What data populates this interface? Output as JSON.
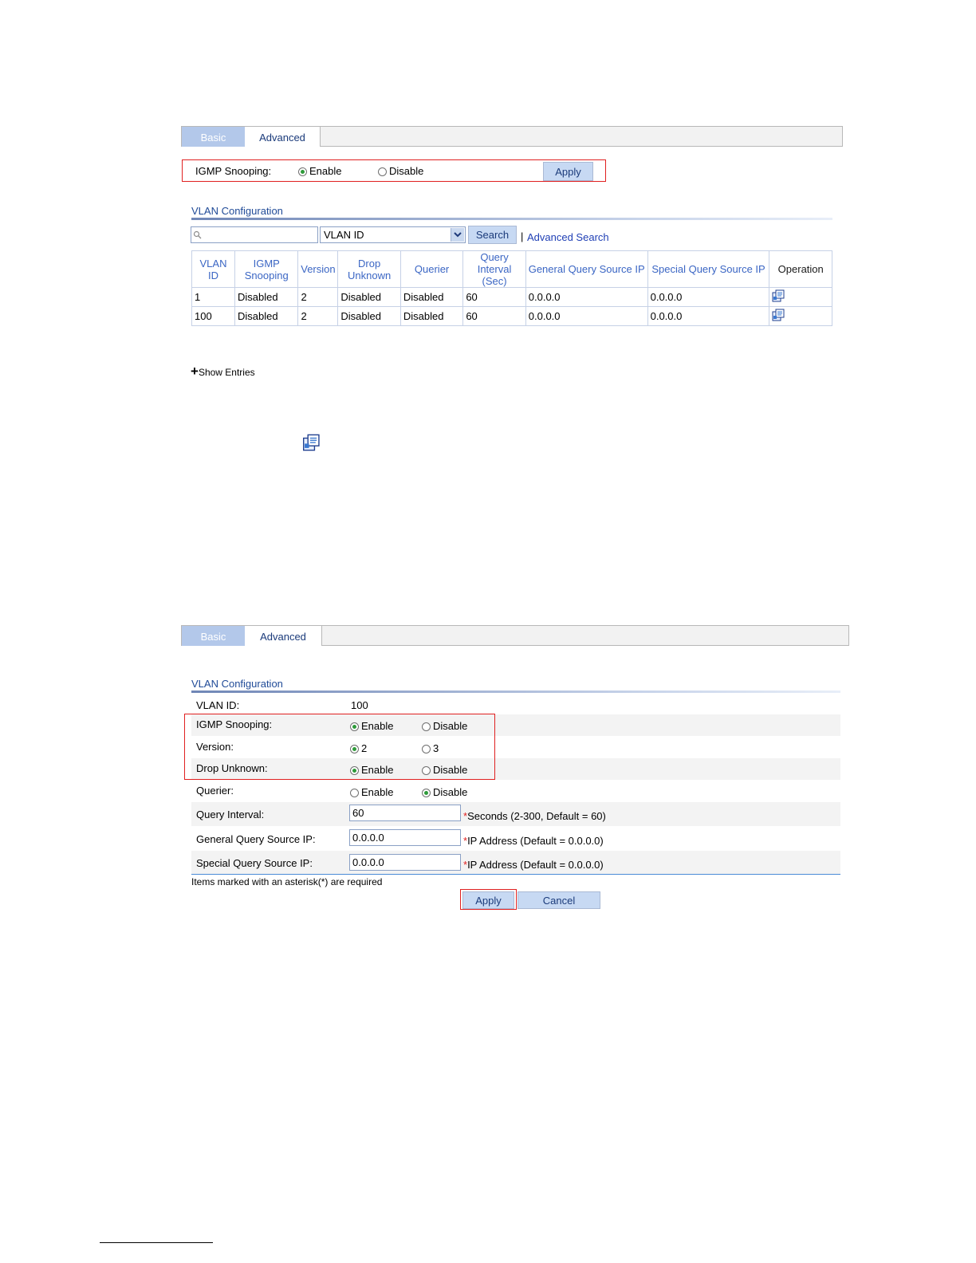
{
  "top_panel": {
    "tabs": [
      {
        "label": "Basic"
      },
      {
        "label": "Advanced"
      }
    ],
    "igmp_snooping_label": "IGMP Snooping:",
    "enable_label": "Enable",
    "disable_label": "Disable",
    "igmp_snooping_selected": "Enable",
    "apply_label": "Apply",
    "vlan_config_title": "VLAN Configuration",
    "search_placeholder": "",
    "search_field_selected": "VLAN ID",
    "search_button": "Search",
    "separator": "|",
    "advanced_search": "Advanced Search",
    "table": {
      "headers": [
        "VLAN ID",
        "IGMP Snooping",
        "Version",
        "Drop Unknown",
        "Querier",
        "Query Interval (Sec)",
        "General Query Source IP",
        "Special Query Source IP",
        "Operation"
      ],
      "header_lines": [
        [
          "VLAN ID"
        ],
        [
          "IGMP",
          "Snooping"
        ],
        [
          "Version"
        ],
        [
          "Drop",
          "Unknown"
        ],
        [
          "Querier"
        ],
        [
          "Query",
          "Interval (Sec)"
        ],
        [
          "General Query Source IP"
        ],
        [
          "Special Query Source IP"
        ],
        [
          "Operation"
        ]
      ],
      "rows": [
        {
          "vlan_id": "1",
          "igmp_snooping": "Disabled",
          "version": "2",
          "drop_unknown": "Disabled",
          "querier": "Disabled",
          "query_interval": "60",
          "general_ip": "0.0.0.0",
          "special_ip": "0.0.0.0"
        },
        {
          "vlan_id": "100",
          "igmp_snooping": "Disabled",
          "version": "2",
          "drop_unknown": "Disabled",
          "querier": "Disabled",
          "query_interval": "60",
          "general_ip": "0.0.0.0",
          "special_ip": "0.0.0.0"
        }
      ]
    },
    "show_entries_plus": "+",
    "show_entries": "Show Entries"
  },
  "bottom_panel": {
    "tabs": [
      {
        "label": "Basic"
      },
      {
        "label": "Advanced"
      }
    ],
    "vlan_config_title": "VLAN Configuration",
    "vlan_id_label": "VLAN ID:",
    "vlan_id_value": "100",
    "igmp_snooping": {
      "label": "IGMP Snooping:",
      "opt1": "Enable",
      "opt2": "Disable",
      "selected": "Enable"
    },
    "version": {
      "label": "Version:",
      "opt1": "2",
      "opt2": "3",
      "selected": "2"
    },
    "drop_unknown": {
      "label": "Drop Unknown:",
      "opt1": "Enable",
      "opt2": "Disable",
      "selected": "Enable"
    },
    "querier": {
      "label": "Querier:",
      "opt1": "Enable",
      "opt2": "Disable",
      "selected": "Disable"
    },
    "query_interval": {
      "label": "Query Interval:",
      "value": "60",
      "star": "*",
      "hint": "Seconds (2-300, Default = 60)"
    },
    "general_query_ip": {
      "label": "General Query Source IP:",
      "value": "0.0.0.0",
      "star": "*",
      "hint": "IP Address (Default = 0.0.0.0)"
    },
    "special_query_ip": {
      "label": "Special Query Source IP:",
      "value": "0.0.0.0",
      "star": "*",
      "hint": "IP Address (Default = 0.0.0.0)"
    },
    "required_note": "Items marked with an asterisk(*) are required",
    "apply_label": "Apply",
    "cancel_label": "Cancel"
  },
  "colors": {
    "accent": "#3b66c4",
    "highlight_box": "#e02020",
    "tab_selected": "#b3c8ea",
    "button": "#c7d9f3"
  }
}
